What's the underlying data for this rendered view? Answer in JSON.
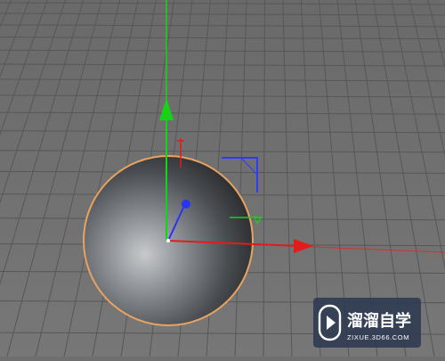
{
  "viewport": {
    "name": "3D Perspective Viewport",
    "background": "#6f6f6f",
    "grid_color": "#575757",
    "floor_color": "#727272",
    "object": {
      "type": "sphere",
      "selection_outline": "#e8a360",
      "shading_dark": "#2e3033",
      "shading_light": "#c7c9cc"
    },
    "gizmo": {
      "x_axis_color": "#e11c1c",
      "y_axis_color": "#16d316",
      "z_axis_color": "#2a33f0",
      "rotate_y_color": "#1ecb1e",
      "scale_corner_color": "#2a3cff"
    }
  },
  "watermark": {
    "name": "溜溜自学",
    "url": "ZIXUE.3D66.COM",
    "icon": "play-logo-icon",
    "badge_bg": "#2d3a52"
  }
}
